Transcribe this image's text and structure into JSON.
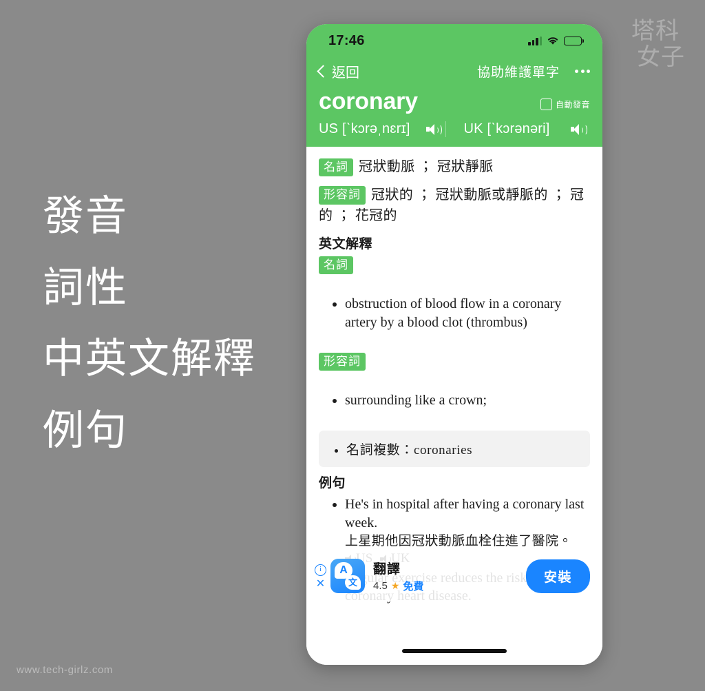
{
  "background": {
    "color": "#8a8a8a",
    "watermark_top": "塔科",
    "watermark_bottom": "女子",
    "site_url": "www.tech-girlz.com"
  },
  "annotations": [
    {
      "label": "發音"
    },
    {
      "label": "詞性"
    },
    {
      "label": "中英文解釋"
    },
    {
      "label": "例句"
    }
  ],
  "phone": {
    "status_bar": {
      "time": "17:46",
      "signal_icon": "cellular-signal-icon",
      "wifi_icon": "wifi-icon",
      "battery_icon": "battery-full-icon"
    },
    "nav": {
      "back_label": "返回",
      "back_icon": "chevron-left-icon",
      "action_label": "協助維護單字",
      "more_icon": "more-dots-icon"
    },
    "word": {
      "headword": "coronary",
      "autoplay_label": "自動發音",
      "autoplay_checked": false,
      "us_label": "US",
      "us_phonetic": "[ˋkɔrəˌnɛrɪ]",
      "uk_label": "UK",
      "uk_phonetic": "[ˋkɔrənəri]",
      "speaker_icon": "speaker-icon"
    },
    "chinese_senses": [
      {
        "pos": "名詞",
        "text": "冠狀動脈 ； 冠狀靜脈"
      },
      {
        "pos": "形容詞",
        "text": "冠狀的 ； 冠狀動脈或靜脈的 ； 冠的 ； 花冠的"
      }
    ],
    "english_section": {
      "title": "英文解釋",
      "groups": [
        {
          "pos": "名詞",
          "definitions": [
            "obstruction of blood flow in a coronary artery by a blood clot (thrombus)"
          ]
        },
        {
          "pos": "形容詞",
          "definitions": [
            "surrounding like a crown;"
          ]
        }
      ]
    },
    "inflection_box": {
      "label": "名詞複數：",
      "value": "coronaries"
    },
    "examples_section": {
      "title": "例句",
      "items": [
        {
          "en": "He's in hospital after having a coronary last week.",
          "zh": "上星期他因冠狀動脈血栓住進了醫院。",
          "audio_us": "US",
          "audio_uk": "UK"
        },
        {
          "en": "Regular exercise reduces the risk of coronary heart disease.",
          "zh": "",
          "audio_us": "",
          "audio_uk": ""
        }
      ]
    },
    "ad": {
      "info_icon": "ad-info-icon",
      "close_icon": "ad-close-icon",
      "app_icon": "translate-app-icon",
      "icon_glyph_a": "A",
      "icon_glyph_w": "文",
      "title": "翻譯",
      "rating": "4.5",
      "star_icon": "star-icon",
      "price": "免費",
      "install_label": "安裝"
    },
    "home_indicator": "home-indicator"
  },
  "colors": {
    "accent_green": "#5cc663",
    "ad_blue": "#1a85ff",
    "page_bg": "#8a8a8a"
  }
}
